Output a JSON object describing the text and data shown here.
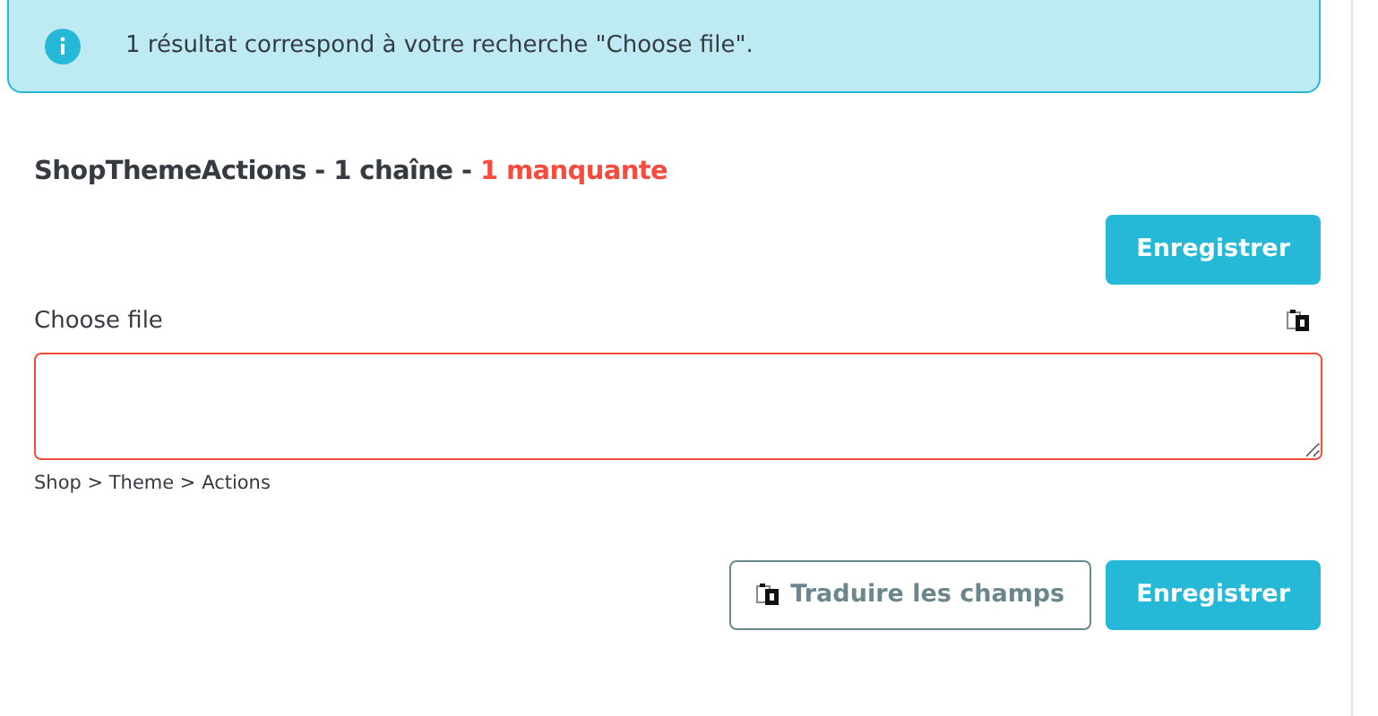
{
  "alert": {
    "text": "1 résultat correspond à votre recherche \"Choose file\"."
  },
  "section": {
    "title": "ShopThemeActions - 1 chaîne - ",
    "missing_text": "1 manquante"
  },
  "top_button": "Enregistrer",
  "field": {
    "label": "Choose file",
    "missing": true,
    "breadcrumb": "Shop > Theme > Actions"
  },
  "buttons": [
    {
      "kind": "outline",
      "label": "Traduire les champs"
    },
    {
      "kind": "primary",
      "label": "Enregistrer"
    }
  ]
}
